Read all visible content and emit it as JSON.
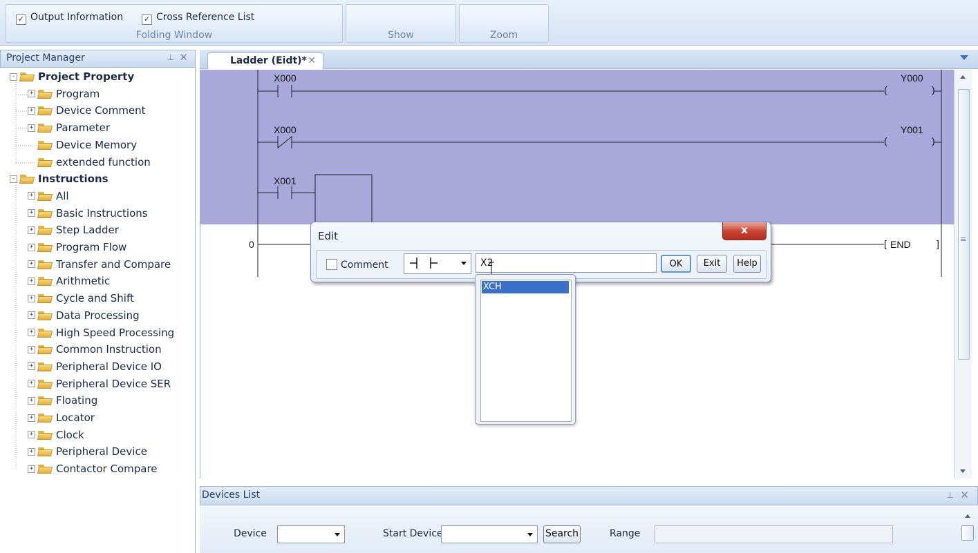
{
  "ribbon": {
    "folding": {
      "output_information": "Output Information",
      "cross_reference_list": "Cross Reference List",
      "group_label": "Folding Window"
    },
    "show_label": "Show",
    "zoom_label": "Zoom"
  },
  "project_manager": {
    "title": "Project Manager",
    "tree": [
      {
        "label": "Project Property",
        "level": 0,
        "bold": true,
        "expander": "-"
      },
      {
        "label": "Program",
        "level": 1,
        "expander": "+"
      },
      {
        "label": "Device Comment",
        "level": 1,
        "expander": "+"
      },
      {
        "label": "Parameter",
        "level": 1,
        "expander": "+"
      },
      {
        "label": "Device Memory",
        "level": 1,
        "expander": ""
      },
      {
        "label": "extended function",
        "level": 1,
        "expander": ""
      },
      {
        "label": "Instructions",
        "level": 0,
        "bold": true,
        "expander": "-"
      },
      {
        "label": "All",
        "level": 1,
        "expander": "+"
      },
      {
        "label": "Basic Instructions",
        "level": 1,
        "expander": "+"
      },
      {
        "label": "Step Ladder",
        "level": 1,
        "expander": "+"
      },
      {
        "label": "Program Flow",
        "level": 1,
        "expander": "+"
      },
      {
        "label": "Transfer and Compare",
        "level": 1,
        "expander": "+"
      },
      {
        "label": "Arithmetic",
        "level": 1,
        "expander": "+"
      },
      {
        "label": "Cycle and Shift",
        "level": 1,
        "expander": "+"
      },
      {
        "label": "Data Processing",
        "level": 1,
        "expander": "+"
      },
      {
        "label": "High Speed Processing",
        "level": 1,
        "expander": "+"
      },
      {
        "label": "Common Instruction",
        "level": 1,
        "expander": "+"
      },
      {
        "label": "Peripheral Device IO",
        "level": 1,
        "expander": "+"
      },
      {
        "label": "Peripheral Device SER",
        "level": 1,
        "expander": "+"
      },
      {
        "label": "Floating",
        "level": 1,
        "expander": "+"
      },
      {
        "label": "Locator",
        "level": 1,
        "expander": "+"
      },
      {
        "label": "Clock",
        "level": 1,
        "expander": "+"
      },
      {
        "label": "Peripheral Device",
        "level": 1,
        "expander": "+"
      },
      {
        "label": "Contactor Compare",
        "level": 1,
        "expander": "+"
      }
    ]
  },
  "editor": {
    "tab_label": "Ladder (Eidt)*",
    "ladder": {
      "rung1_contact": "X000",
      "rung1_coil": "Y000",
      "rung2_contact": "X000",
      "rung2_coil": "Y001",
      "rung3_contact": "X001",
      "step_number": "0",
      "end_label": "END",
      "coil_open": "(",
      "coil_close": ")",
      "end_open": "[",
      "end_close": "]"
    }
  },
  "edit_dialog": {
    "title": "Edit",
    "close_label": "x",
    "comment_label": "Comment",
    "contact_symbol": "┤ ├",
    "input_value": "X2",
    "ok_label": "OK",
    "exit_label": "Exit",
    "help_label": "Help",
    "suggestion": "XCH"
  },
  "devices_list": {
    "title": "Devices List",
    "device_label": "Device",
    "start_device_label": "Start Device",
    "search_label": "Search",
    "range_label": "Range"
  },
  "colors": {
    "selection_highlight": "#a8a9da",
    "autocomplete_selected": "#3b6fc8",
    "dialog_close": "#c7402f"
  }
}
